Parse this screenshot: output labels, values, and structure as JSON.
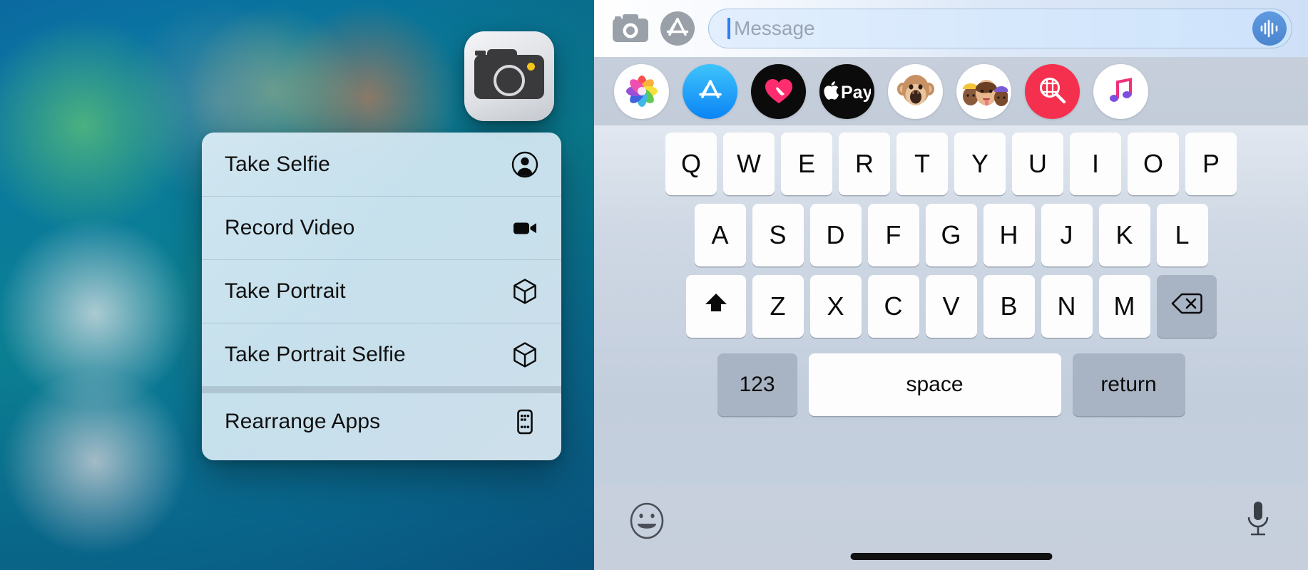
{
  "left_panel": {
    "name": "ios-home-screen-with-quick-actions",
    "app_icon": {
      "name": "camera-app-icon",
      "label": "Camera"
    },
    "context_menu": {
      "items": [
        {
          "label": "Take Selfie",
          "icon": "person-circle-icon",
          "group": 1
        },
        {
          "label": "Record Video",
          "icon": "video-camera-icon",
          "group": 1
        },
        {
          "label": "Take Portrait",
          "icon": "cube-icon",
          "group": 1
        },
        {
          "label": "Take Portrait Selfie",
          "icon": "cube-icon",
          "group": 1
        },
        {
          "label": "Rearrange Apps",
          "icon": "app-grid-phone-icon",
          "group": 2
        }
      ]
    }
  },
  "right_panel": {
    "name": "ios-messages-compose",
    "input_bar": {
      "camera_icon": "camera-icon",
      "apps_icon": "app-store-icon",
      "placeholder": "Message",
      "value": "",
      "audio_button_icon": "audio-waveform-icon"
    },
    "app_drawer": {
      "apps": [
        {
          "name": "photos",
          "label": "Photos"
        },
        {
          "name": "app-store",
          "label": "App Store"
        },
        {
          "name": "digital-touch",
          "label": "Digital Touch"
        },
        {
          "name": "apple-pay",
          "label": "Apple Pay"
        },
        {
          "name": "animoji",
          "label": "Animoji"
        },
        {
          "name": "memoji",
          "label": "Memoji Stickers"
        },
        {
          "name": "images",
          "label": "#images"
        },
        {
          "name": "music",
          "label": "Music"
        }
      ]
    },
    "keyboard": {
      "row1": [
        "Q",
        "W",
        "E",
        "R",
        "T",
        "Y",
        "U",
        "I",
        "O",
        "P"
      ],
      "row2": [
        "A",
        "S",
        "D",
        "F",
        "G",
        "H",
        "J",
        "K",
        "L"
      ],
      "row3": [
        "Z",
        "X",
        "C",
        "V",
        "B",
        "N",
        "M"
      ],
      "shift_icon": "shift-arrow-icon",
      "delete_icon": "delete-backward-icon",
      "numbers_key": "123",
      "space_key": "space",
      "return_key": "return"
    },
    "bottom_bar": {
      "emoji_icon": "emoji-smiley-icon",
      "dictation_icon": "microphone-icon",
      "home_indicator": "home-indicator"
    }
  },
  "colors": {
    "menu_bg": "#d2e6f1",
    "accent_blue": "#2b7cf6",
    "key_light": "#fdfdfd",
    "key_dark": "#a8b3c3",
    "images_red": "#f5304f",
    "appstore_blue": "#1e9bf5"
  }
}
